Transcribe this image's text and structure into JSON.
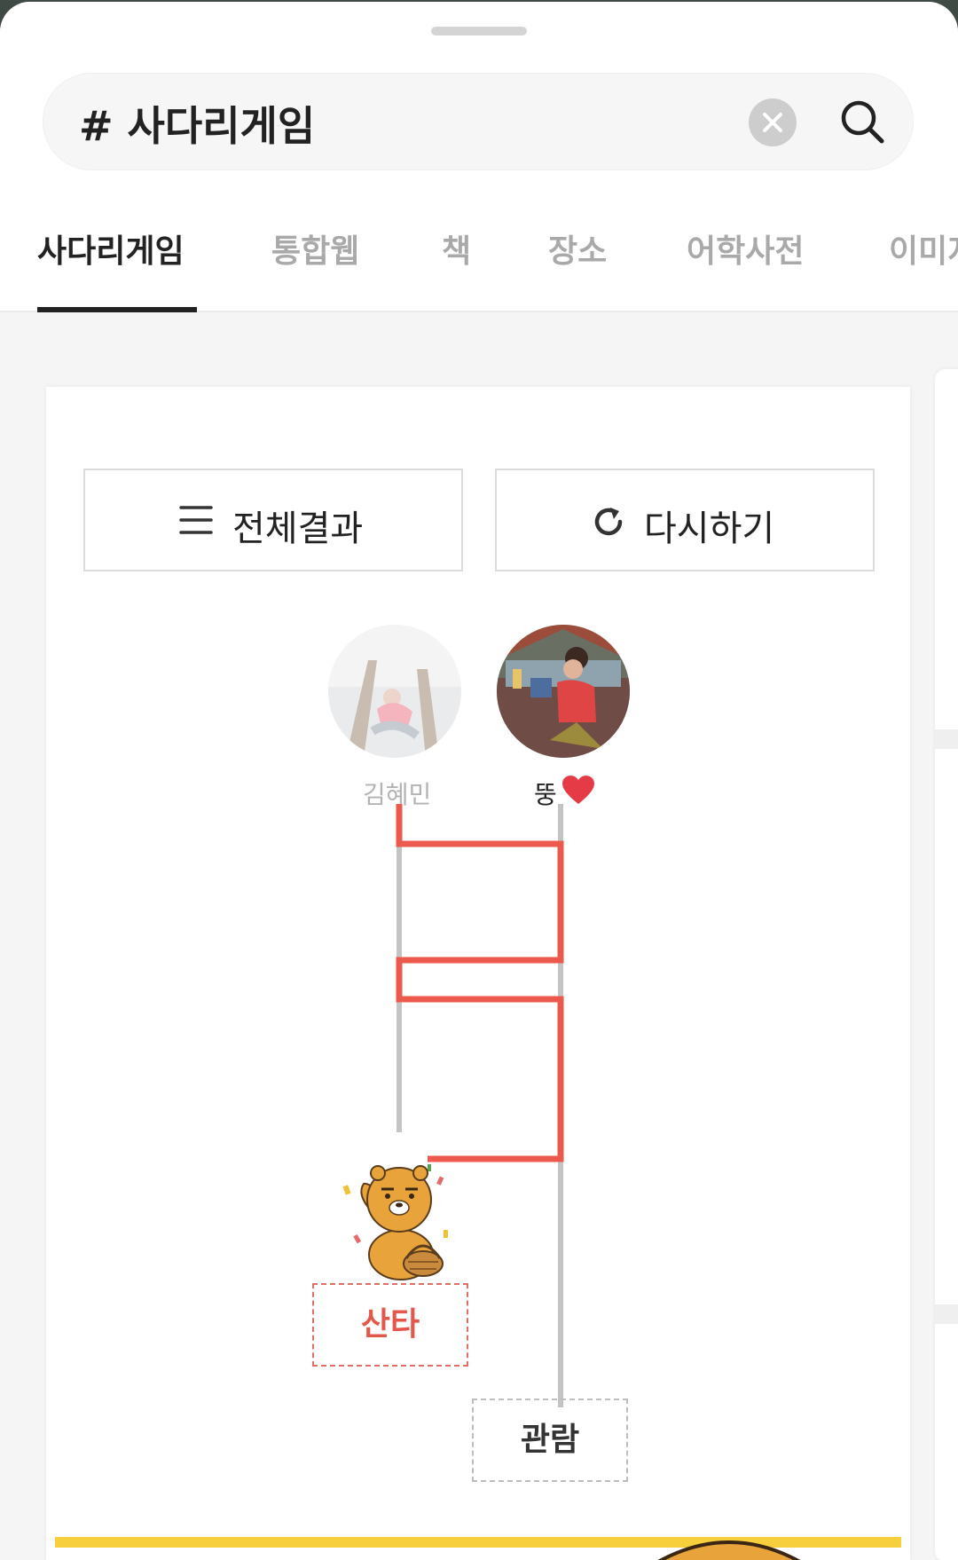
{
  "search": {
    "query": "# 사다리게임"
  },
  "tabs": [
    {
      "label": "사다리게임",
      "active": true
    },
    {
      "label": "통합웹"
    },
    {
      "label": "책"
    },
    {
      "label": "장소"
    },
    {
      "label": "어학사전"
    },
    {
      "label": "이미지"
    }
  ],
  "game": {
    "all_results_label": "전체결과",
    "retry_label": "다시하기",
    "players": [
      {
        "name": "김혜민",
        "faded": true
      },
      {
        "name": "뚱",
        "badge": "❤️",
        "faded": false
      }
    ],
    "results": [
      {
        "label": "산타",
        "winner": true
      },
      {
        "label": "관람",
        "winner": false
      }
    ],
    "winner_character": "ryan-character"
  },
  "colors": {
    "ladder_highlight": "#eb5a4c",
    "ladder_base": "#c4c4c4",
    "active_tab": "#222222",
    "accent_bar": "#f7cf3d"
  },
  "icons": [
    "clear-icon",
    "search-icon",
    "list-icon",
    "refresh-icon",
    "heart-icon"
  ]
}
